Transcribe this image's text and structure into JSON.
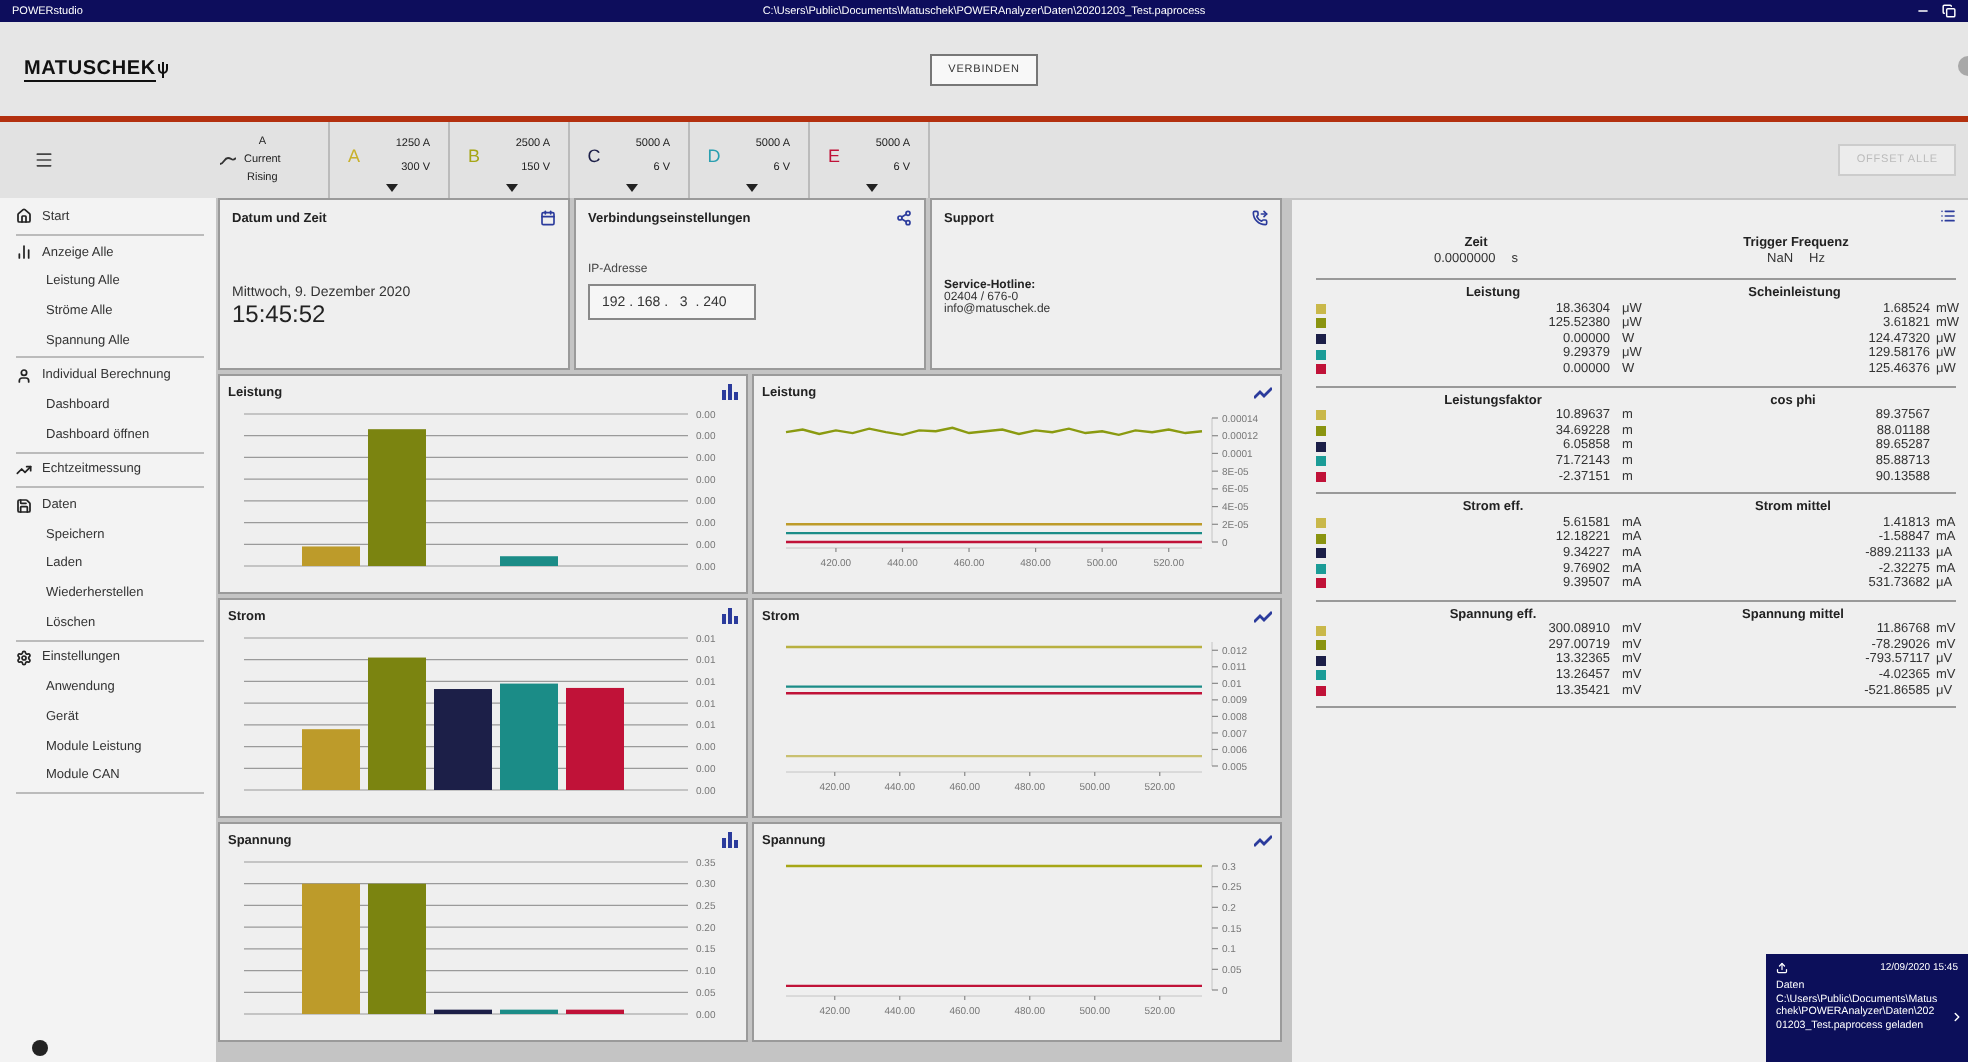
{
  "title_bar": {
    "app": "POWERstudio",
    "path": "C:\\Users\\Public\\Documents\\Matuschek\\POWERAnalyzer\\Daten\\20201203_Test.paprocess"
  },
  "header": {
    "logo": "MATUSCHEK",
    "connect_button": "VERBINDEN"
  },
  "toolbar": {
    "trigger": {
      "channel": "A",
      "signal": "Current",
      "edge": "Rising"
    },
    "channels": [
      {
        "letter": "A",
        "color": "#c9b12c",
        "current": "1250 A",
        "voltage": "300 V"
      },
      {
        "letter": "B",
        "color": "#a6a616",
        "current": "2500 A",
        "voltage": "150 V"
      },
      {
        "letter": "C",
        "color": "#1c1f48",
        "current": "5000 A",
        "voltage": "6 V"
      },
      {
        "letter": "D",
        "color": "#2a9fb0",
        "current": "5000 A",
        "voltage": "6 V"
      },
      {
        "letter": "E",
        "color": "#c01238",
        "current": "5000 A",
        "voltage": "6 V"
      }
    ],
    "offset_button": {
      "label": "OFFSET ALLE",
      "disabled": true
    }
  },
  "sidebar": {
    "items": [
      {
        "label": "Start"
      },
      {
        "label": "Anzeige Alle",
        "children": [
          {
            "label": "Leistung Alle"
          },
          {
            "label": "Ströme Alle"
          },
          {
            "label": "Spannung Alle"
          }
        ]
      },
      {
        "label": "Individual Berechnung",
        "children": [
          {
            "label": "Dashboard"
          },
          {
            "label": "Dashboard öffnen"
          }
        ]
      },
      {
        "label": "Echtzeitmessung"
      },
      {
        "label": "Daten",
        "children": [
          {
            "label": "Speichern"
          },
          {
            "label": "Laden"
          },
          {
            "label": "Wiederherstellen"
          },
          {
            "label": "Löschen"
          }
        ]
      },
      {
        "label": "Einstellungen",
        "children": [
          {
            "label": "Anwendung"
          },
          {
            "label": "Gerät"
          },
          {
            "label": "Module Leistung"
          },
          {
            "label": "Module CAN"
          }
        ]
      }
    ]
  },
  "cards": {
    "date_time": {
      "title": "Datum und Zeit",
      "date": "Mittwoch, 9. Dezember 2020",
      "time": "15:45:52"
    },
    "connection": {
      "title": "Verbindungseinstellungen",
      "ip_label": "IP-Adresse",
      "ip": "192 . 168 .   3  . 240"
    },
    "support": {
      "title": "Support",
      "hotline_label": "Service-Hotline:",
      "phone": "02404 / 676-0",
      "email": "info@matuschek.de"
    }
  },
  "charts": [
    {
      "chart_data": {
        "type": "bar",
        "title": "Leistung",
        "grid": true,
        "ylim": [
          0,
          0.00014
        ],
        "yticks": [
          {
            "value": 0,
            "label": "0.00"
          },
          {
            "value": 2e-05,
            "label": "0.00"
          },
          {
            "value": 4e-05,
            "label": "0.00"
          },
          {
            "value": 6e-05,
            "label": "0.00"
          },
          {
            "value": 8e-05,
            "label": "0.00"
          },
          {
            "value": 0.0001,
            "label": "0.00"
          },
          {
            "value": 0.00012,
            "label": "0.00"
          },
          {
            "value": 0.00014,
            "label": "0.00"
          }
        ],
        "series": [
          {
            "color": "#bd9b2a",
            "values": [
              1.8e-05
            ]
          },
          {
            "color": "#7b8410",
            "values": [
              0.000126
            ]
          },
          {
            "color": "#1c1f48",
            "values": [
              0
            ]
          },
          {
            "color": "#1b8c87",
            "values": [
              9e-06
            ]
          },
          {
            "color": "#c01238",
            "values": [
              0
            ]
          }
        ]
      }
    },
    {
      "chart_data": {
        "type": "line",
        "title": "Leistung",
        "xlim": [
          405,
          530
        ],
        "ylim": [
          0,
          0.00014
        ],
        "x": [
          405,
          410,
          415,
          420,
          425,
          430,
          435,
          440,
          445,
          450,
          455,
          460,
          465,
          470,
          475,
          480,
          485,
          490,
          495,
          500,
          505,
          510,
          515,
          520,
          525,
          530
        ],
        "xticks": [
          {
            "value": 420,
            "label": "420.00"
          },
          {
            "value": 440,
            "label": "440.00"
          },
          {
            "value": 460,
            "label": "460.00"
          },
          {
            "value": 480,
            "label": "480.00"
          },
          {
            "value": 500,
            "label": "500.00"
          },
          {
            "value": 520,
            "label": "520.00"
          }
        ],
        "yticks": [
          {
            "value": 0.00014,
            "label": "0.00014"
          },
          {
            "value": 0.00012,
            "label": "0.00012"
          },
          {
            "value": 0.0001,
            "label": "0.0001"
          },
          {
            "value": 8e-05,
            "label": "8E-05"
          },
          {
            "value": 6e-05,
            "label": "6E-05"
          },
          {
            "value": 4e-05,
            "label": "4E-05"
          },
          {
            "value": 2e-05,
            "label": "2E-05"
          },
          {
            "value": 0,
            "label": "0"
          }
        ],
        "series": [
          {
            "color": "#bd9b2a",
            "values": [
              2e-05,
              2e-05,
              2e-05,
              2e-05,
              2e-05,
              2e-05,
              2e-05,
              2e-05,
              2e-05,
              2e-05,
              2e-05,
              2e-05,
              2e-05,
              2e-05,
              2e-05,
              2e-05,
              2e-05,
              2e-05,
              2e-05,
              2e-05,
              2e-05,
              2e-05,
              2e-05,
              2e-05,
              2e-05,
              2e-05
            ]
          },
          {
            "color": "#8a9a10",
            "values": [
              0.000124,
              0.000127,
              0.000122,
              0.000126,
              0.000123,
              0.000128,
              0.000124,
              0.000121,
              0.000126,
              0.000125,
              0.000129,
              0.000123,
              0.000125,
              0.000127,
              0.000122,
              0.000126,
              0.000124,
              0.000128,
              0.000123,
              0.000125,
              0.000121,
              0.000126,
              0.000124,
              0.000127,
              0.000123,
              0.000125
            ]
          },
          {
            "color": "#1b8c87",
            "values": [
              1e-05,
              1e-05,
              1e-05,
              1e-05,
              1e-05,
              1e-05,
              1e-05,
              1e-05,
              1e-05,
              1e-05,
              1e-05,
              1e-05,
              1e-05,
              1e-05,
              1e-05,
              1e-05,
              1e-05,
              1e-05,
              1e-05,
              1e-05,
              1e-05,
              1e-05,
              1e-05,
              1e-05,
              1e-05,
              1e-05
            ]
          },
          {
            "color": "#c01238",
            "values": [
              0,
              0,
              0,
              0,
              0,
              0,
              0,
              0,
              0,
              0,
              0,
              0,
              0,
              0,
              0,
              0,
              0,
              0,
              0,
              0,
              0,
              0,
              0,
              0,
              0,
              0
            ]
          }
        ]
      }
    },
    {
      "chart_data": {
        "type": "bar",
        "title": "Strom",
        "grid": true,
        "ylim": [
          0,
          0.014
        ],
        "yticks": [
          {
            "value": 0,
            "label": "0.00"
          },
          {
            "value": 0.002,
            "label": "0.00"
          },
          {
            "value": 0.004,
            "label": "0.00"
          },
          {
            "value": 0.006,
            "label": "0.01"
          },
          {
            "value": 0.008,
            "label": "0.01"
          },
          {
            "value": 0.01,
            "label": "0.01"
          },
          {
            "value": 0.012,
            "label": "0.01"
          },
          {
            "value": 0.014,
            "label": "0.01"
          }
        ],
        "series": [
          {
            "color": "#bd9b2a",
            "values": [
              0.0056
            ]
          },
          {
            "color": "#7b8410",
            "values": [
              0.0122
            ]
          },
          {
            "color": "#1c1f48",
            "values": [
              0.0093
            ]
          },
          {
            "color": "#1b8c87",
            "values": [
              0.0098
            ]
          },
          {
            "color": "#c01238",
            "values": [
              0.0094
            ]
          }
        ]
      }
    },
    {
      "chart_data": {
        "type": "line",
        "title": "Strom",
        "xlim": [
          405,
          533
        ],
        "ylim": [
          0.005,
          0.0125
        ],
        "x": [
          405,
          533
        ],
        "xticks": [
          {
            "value": 420,
            "label": "420.00"
          },
          {
            "value": 440,
            "label": "440.00"
          },
          {
            "value": 460,
            "label": "460.00"
          },
          {
            "value": 480,
            "label": "480.00"
          },
          {
            "value": 500,
            "label": "500.00"
          },
          {
            "value": 520,
            "label": "520.00"
          }
        ],
        "yticks": [
          0.012,
          0.011,
          {
            "value": 0.01,
            "label": "0.01"
          },
          0.009,
          0.008,
          0.007,
          0.006,
          0.005
        ],
        "series": [
          {
            "color": "#c9c070",
            "values": [
              0.0056,
              0.0056
            ]
          },
          {
            "color": "#b8b040",
            "values": [
              0.0122,
              0.0122
            ]
          },
          {
            "color": "#1b8c87",
            "values": [
              0.0098,
              0.0098
            ]
          },
          {
            "color": "#c01238",
            "values": [
              0.0094,
              0.0094
            ]
          }
        ]
      }
    },
    {
      "chart_data": {
        "type": "bar",
        "title": "Spannung",
        "grid": true,
        "ylim": [
          0,
          0.35
        ],
        "yticks": [
          {
            "value": 0,
            "label": "0.00"
          },
          {
            "value": 0.05,
            "label": "0.05"
          },
          {
            "value": 0.1,
            "label": "0.10"
          },
          {
            "value": 0.15,
            "label": "0.15"
          },
          {
            "value": 0.2,
            "label": "0.20"
          },
          {
            "value": 0.25,
            "label": "0.25"
          },
          {
            "value": 0.3,
            "label": "0.30"
          },
          {
            "value": 0.35,
            "label": "0.35"
          }
        ],
        "series": [
          {
            "color": "#bd9b2a",
            "values": [
              0.3
            ]
          },
          {
            "color": "#7b8410",
            "values": [
              0.3
            ]
          },
          {
            "color": "#1c1f48",
            "values": [
              0.01
            ]
          },
          {
            "color": "#1b8c87",
            "values": [
              0.01
            ]
          },
          {
            "color": "#c01238",
            "values": [
              0.01
            ]
          }
        ]
      }
    },
    {
      "chart_data": {
        "type": "line",
        "title": "Spannung",
        "xlim": [
          405,
          533
        ],
        "ylim": [
          0,
          0.3
        ],
        "x": [
          405,
          533
        ],
        "xticks": [
          {
            "value": 420,
            "label": "420.00"
          },
          {
            "value": 440,
            "label": "440.00"
          },
          {
            "value": 460,
            "label": "460.00"
          },
          {
            "value": 480,
            "label": "480.00"
          },
          {
            "value": 500,
            "label": "500.00"
          },
          {
            "value": 520,
            "label": "520.00"
          }
        ],
        "yticks": [
          0.3,
          0.25,
          0.2,
          0.15,
          0.1,
          0.05,
          0
        ],
        "series": [
          {
            "color": "#a6a616",
            "values": [
              0.3,
              0.3
            ]
          },
          {
            "color": "#c01238",
            "values": [
              0.01,
              0.01
            ]
          }
        ]
      }
    }
  ],
  "measurements": {
    "time": {
      "label": "Zeit",
      "value": "0.0000000",
      "unit": "s"
    },
    "trigger": {
      "label": "Trigger Frequenz",
      "value": "NaN",
      "unit": "Hz"
    },
    "sections": [
      {
        "left": {
          "title": "Leistung",
          "rows": [
            {
              "color": "#c9b84a",
              "value": "18.36304",
              "unit": "μW"
            },
            {
              "color": "#8a9410",
              "value": "125.52380",
              "unit": "μW"
            },
            {
              "color": "#1c1f48",
              "value": "0.00000",
              "unit": "W"
            },
            {
              "color": "#1b9c97",
              "value": "9.29379",
              "unit": "μW"
            },
            {
              "color": "#c01238",
              "value": "0.00000",
              "unit": "W"
            }
          ]
        },
        "right": {
          "title": "Scheinleistung",
          "rows": [
            {
              "value": "1.68524",
              "unit": "mW"
            },
            {
              "value": "3.61821",
              "unit": "mW"
            },
            {
              "value": "124.47320",
              "unit": "μW"
            },
            {
              "value": "129.58176",
              "unit": "μW"
            },
            {
              "value": "125.46376",
              "unit": "μW"
            }
          ]
        }
      },
      {
        "left": {
          "title": "Leistungsfaktor",
          "rows": [
            {
              "color": "#c9b84a",
              "value": "10.89637",
              "unit": "m"
            },
            {
              "color": "#8a9410",
              "value": "34.69228",
              "unit": "m"
            },
            {
              "color": "#1c1f48",
              "value": "6.05858",
              "unit": "m"
            },
            {
              "color": "#1b9c97",
              "value": "71.72143",
              "unit": "m"
            },
            {
              "color": "#c01238",
              "value": "-2.37151",
              "unit": "m"
            }
          ]
        },
        "right": {
          "title": "cos phi",
          "rows": [
            {
              "value": "89.37567"
            },
            {
              "value": "88.01188"
            },
            {
              "value": "89.65287"
            },
            {
              "value": "85.88713"
            },
            {
              "value": "90.13588"
            }
          ]
        }
      },
      {
        "left": {
          "title": "Strom eff.",
          "rows": [
            {
              "color": "#c9b84a",
              "value": "5.61581",
              "unit": "mA"
            },
            {
              "color": "#8a9410",
              "value": "12.18221",
              "unit": "mA"
            },
            {
              "color": "#1c1f48",
              "value": "9.34227",
              "unit": "mA"
            },
            {
              "color": "#1b9c97",
              "value": "9.76902",
              "unit": "mA"
            },
            {
              "color": "#c01238",
              "value": "9.39507",
              "unit": "mA"
            }
          ]
        },
        "right": {
          "title": "Strom mittel",
          "rows": [
            {
              "value": "1.41813",
              "unit": "mA"
            },
            {
              "value": "-1.58847",
              "unit": "mA"
            },
            {
              "value": "-889.21133",
              "unit": "μA"
            },
            {
              "value": "-2.32275",
              "unit": "mA"
            },
            {
              "value": "531.73682",
              "unit": "μA"
            }
          ]
        }
      },
      {
        "left": {
          "title": "Spannung eff.",
          "rows": [
            {
              "color": "#c9b84a",
              "value": "300.08910",
              "unit": "mV"
            },
            {
              "color": "#8a9410",
              "value": "297.00719",
              "unit": "mV"
            },
            {
              "color": "#1c1f48",
              "value": "13.32365",
              "unit": "mV"
            },
            {
              "color": "#1b9c97",
              "value": "13.26457",
              "unit": "mV"
            },
            {
              "color": "#c01238",
              "value": "13.35421",
              "unit": "mV"
            }
          ]
        },
        "right": {
          "title": "Spannung mittel",
          "rows": [
            {
              "value": "11.86768",
              "unit": "mV"
            },
            {
              "value": "-78.29026",
              "unit": "mV"
            },
            {
              "value": "-793.57117",
              "unit": "μV"
            },
            {
              "value": "-4.02365",
              "unit": "mV"
            },
            {
              "value": "-521.86585",
              "unit": "μV"
            }
          ]
        }
      }
    ]
  },
  "toast": {
    "time": "12/09/2020 15:45",
    "message": "Daten C:\\Users\\Public\\Documents\\Matuschek\\POWERAnalyzer\\Daten\\20201203_Test.paprocess geladen"
  }
}
